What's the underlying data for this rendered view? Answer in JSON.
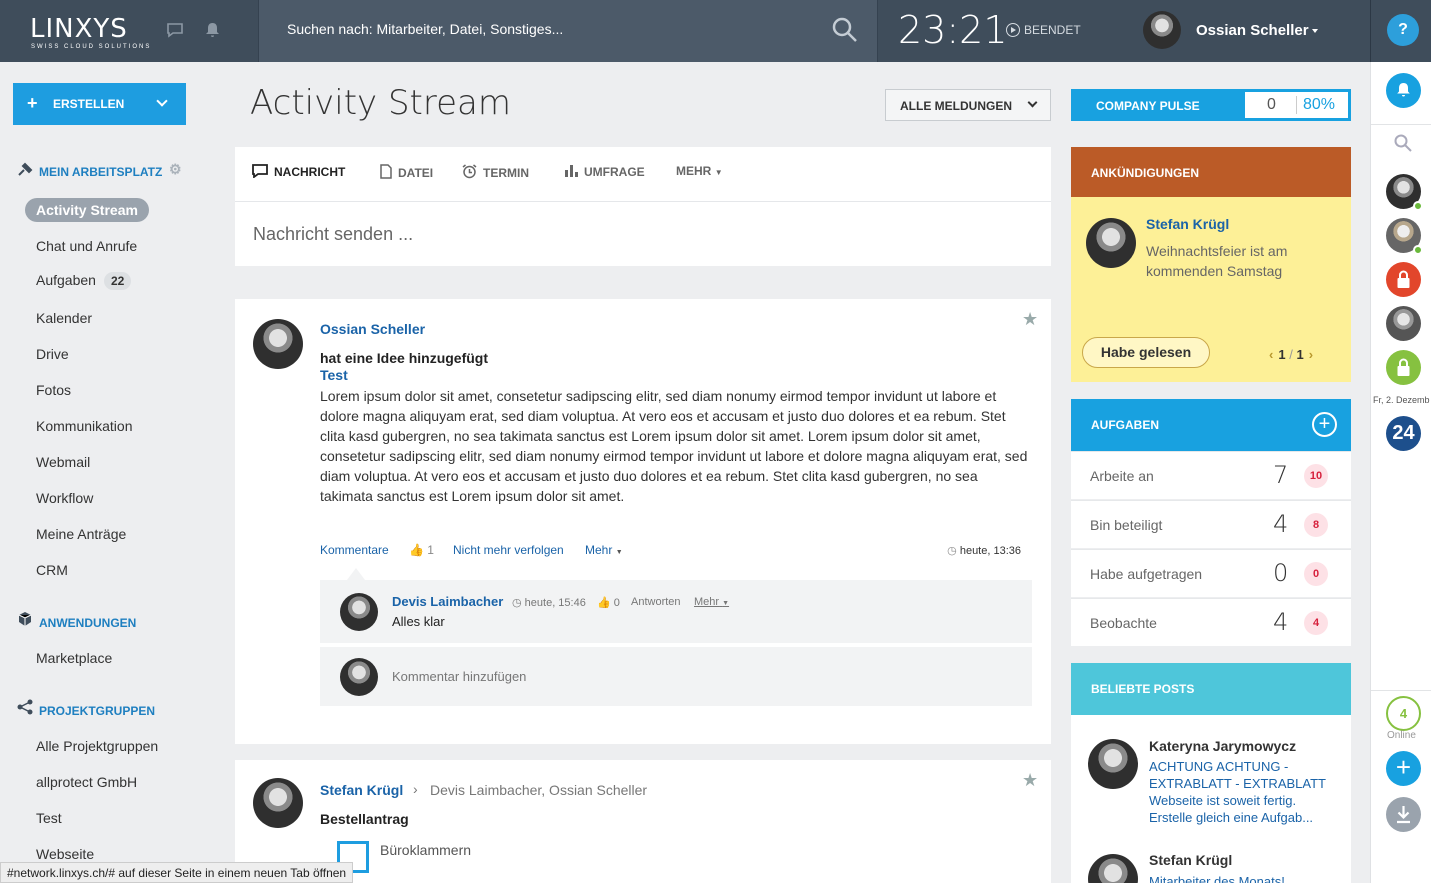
{
  "header": {
    "logo": "LINXYS",
    "logo_tagline": "SWISS CLOUD SOLUTIONS",
    "search_placeholder": "Suchen nach: Mitarbeiter, Datei, Sonstiges...",
    "clock": "23:21",
    "timer_status": "BEENDET",
    "user_name": "Ossian Scheller",
    "help": "?"
  },
  "sidebar": {
    "create_label": "ERSTELLEN",
    "workspace_title": "MEIN ARBEITSPLATZ",
    "workspace_items": [
      {
        "label": "Activity Stream"
      },
      {
        "label": "Chat und Anrufe"
      },
      {
        "label": "Aufgaben",
        "badge": "22"
      },
      {
        "label": "Kalender"
      },
      {
        "label": "Drive"
      },
      {
        "label": "Fotos"
      },
      {
        "label": "Kommunikation"
      },
      {
        "label": "Webmail"
      },
      {
        "label": "Workflow"
      },
      {
        "label": "Meine Anträge"
      },
      {
        "label": "CRM"
      }
    ],
    "apps_title": "ANWENDUNGEN",
    "apps_items": [
      {
        "label": "Marketplace"
      }
    ],
    "groups_title": "PROJEKTGRUPPEN",
    "groups_items": [
      {
        "label": "Alle Projektgruppen"
      },
      {
        "label": "allprotect GmbH"
      },
      {
        "label": "Test"
      },
      {
        "label": "Webseite"
      }
    ]
  },
  "main": {
    "title": "Activity Stream",
    "filter_label": "ALLE MELDUNGEN",
    "composer_tabs": [
      "NACHRICHT",
      "DATEI",
      "TERMIN",
      "UMFRAGE",
      "MEHR"
    ],
    "composer_placeholder": "Nachricht senden ..."
  },
  "post1": {
    "author": "Ossian Scheller",
    "action": "hat eine Idee hinzugefügt",
    "title": "Test",
    "body": "Lorem ipsum dolor sit amet, consetetur sadipscing elitr, sed diam nonumy eirmod tempor invidunt ut labore et dolore magna aliquyam erat, sed diam voluptua. At vero eos et accusam et justo duo dolores et ea rebum. Stet clita kasd gubergren, no sea takimata sanctus est Lorem ipsum dolor sit amet. Lorem ipsum dolor sit amet, consetetur sadipscing elitr, sed diam nonumy eirmod tempor invidunt ut labore et dolore magna aliquyam erat, sed diam voluptua. At vero eos et accusam et justo duo dolores et ea rebum. Stet clita kasd gubergren, no sea takimata sanctus est Lorem ipsum dolor sit amet.",
    "comments_label": "Kommentare",
    "like_count": "1",
    "unfollow_label": "Nicht mehr verfolgen",
    "more_label": "Mehr",
    "time": "heute, 13:36",
    "comment": {
      "author": "Devis Laimbacher",
      "time": "heute, 15:46",
      "like_count": "0",
      "reply_label": "Antworten",
      "more_label": "Mehr",
      "text": "Alles klar"
    },
    "add_comment_placeholder": "Kommentar hinzufügen"
  },
  "post2": {
    "author": "Stefan Krügl",
    "recipients": "Devis Laimbacher, Ossian Scheller",
    "title": "Bestellantrag",
    "item": "Büroklammern"
  },
  "right": {
    "pulse_label": "COMPANY PULSE",
    "pulse_value": "0",
    "pulse_percent": "80%",
    "announcements_title": "ANKÜNDIGUNGEN",
    "announcement": {
      "author": "Stefan Krügl",
      "text": "Weihnachtsfeier ist am kommenden Samstag",
      "read_button": "Habe gelesen",
      "page_current": "1",
      "page_sep": "/",
      "page_total": "1"
    },
    "tasks_title": "AUFGABEN",
    "tasks": [
      {
        "label": "Arbeite an",
        "count": "7",
        "badge": "10"
      },
      {
        "label": "Bin beteiligt",
        "count": "4",
        "badge": "8"
      },
      {
        "label": "Habe aufgetragen",
        "count": "0",
        "badge": "0"
      },
      {
        "label": "Beobachte",
        "count": "4",
        "badge": "4"
      }
    ],
    "popular_title": "BELIEBTE POSTS",
    "popular": [
      {
        "author": "Kateryna Jarymowycz",
        "text": "ACHTUNG ACHTUNG - EXTRABLATT - EXTRABLATT Webseite ist soweit fertig. Erstelle gleich eine Aufgab..."
      },
      {
        "author": "Stefan Krügl",
        "text": "Mitarbeiter des Monats!"
      }
    ]
  },
  "rail": {
    "date_label": "Fr, 2. Dezemb",
    "calendar_day": "24",
    "online_count": "4",
    "online_label": "Online"
  },
  "status_bar": "#network.linxys.ch/# auf dieser Seite in einem neuen Tab öffnen",
  "colors": {
    "topbar": "#3f4d5b",
    "accent_blue": "#18a1e0",
    "announcement_header": "#bb5b27",
    "announcement_body": "#fdf097",
    "popular_header": "#4ec6da"
  }
}
